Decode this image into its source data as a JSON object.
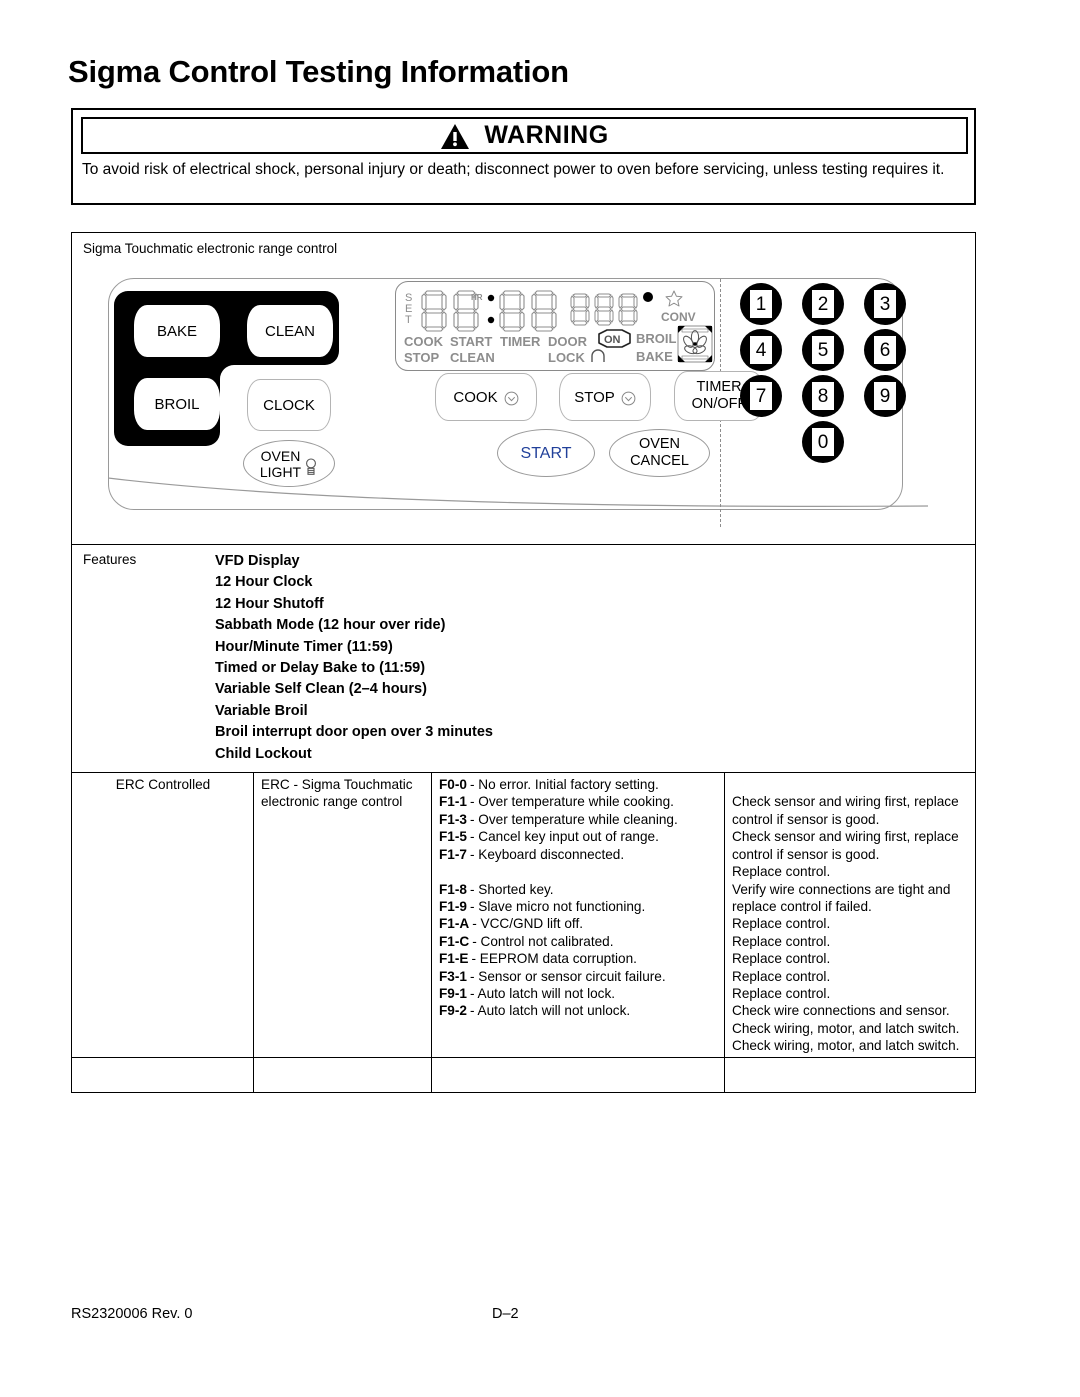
{
  "title": "Sigma Control Testing Information",
  "warning": {
    "heading": "WARNING",
    "icon": "warning-triangle-icon",
    "body": "To avoid risk of electrical shock, personal injury or death; disconnect power to oven before servicing, unless testing requires it."
  },
  "panel": {
    "caption": "Sigma Touchmatic electronic range control",
    "keys": {
      "bake": "BAKE",
      "clean": "CLEAN",
      "broil": "BROIL",
      "clock": "CLOCK",
      "oven_light_line1": "OVEN",
      "oven_light_line2": "LIGHT",
      "cook": "COOK",
      "stop": "STOP",
      "timer_line1": "TIMER",
      "timer_line2": "ON/OFF",
      "start": "START",
      "oven_cancel_line1": "OVEN",
      "oven_cancel_line2": "CANCEL"
    },
    "start_color": "#21409a",
    "keypad": [
      "1",
      "2",
      "3",
      "4",
      "5",
      "6",
      "7",
      "8",
      "9",
      "0"
    ],
    "vfd": {
      "set_indicator": "SET",
      "hr_marker": "HR",
      "row1": [
        "COOK",
        "START",
        "TIMER",
        "DOOR"
      ],
      "row2": [
        "STOP",
        "CLEAN",
        "LOCK"
      ],
      "on_indicator": "ON",
      "broil": "BROIL",
      "bake": "BAKE",
      "conv": "CONV",
      "icons": [
        "star-icon",
        "degree-dot-icon",
        "padlock-icon",
        "convection-fan-icon"
      ]
    }
  },
  "features": {
    "label": "Features",
    "items": [
      "VFD Display",
      "12 Hour Clock",
      "12 Hour Shutoff",
      "Sabbath Mode (12 hour over ride)",
      "Hour/Minute Timer (11:59)",
      "Timed or Delay Bake to (11:59)",
      "Variable Self Clean (2–4 hours)",
      "Variable Broil",
      "Broil interrupt door open over 3 minutes",
      "Child Lockout"
    ]
  },
  "error_table": {
    "category": "ERC Controlled",
    "control_name": "ERC - Sigma Touchmatic electronic range control",
    "codes": [
      {
        "id": "F0-0",
        "desc": "No error. Initial factory setting.",
        "remedy": ""
      },
      {
        "id": "F1-1",
        "desc": "Over temperature while cooking.",
        "remedy": "Check sensor and wiring first, replace control if sensor is good."
      },
      {
        "id": "F1-3",
        "desc": "Over temperature while cleaning.",
        "remedy": "Check sensor and wiring first, replace control if sensor is good."
      },
      {
        "id": "F1-5",
        "desc": "Cancel key input out of range.",
        "remedy": "Replace control."
      },
      {
        "id": "F1-7",
        "desc": "Keyboard disconnected.",
        "remedy": "Verify wire connections are tight and replace control if failed."
      },
      {
        "id": "F1-8",
        "desc": "Shorted key.",
        "remedy": "Replace control."
      },
      {
        "id": "F1-9",
        "desc": "Slave micro not functioning.",
        "remedy": "Replace control."
      },
      {
        "id": "F1-A",
        "desc": "VCC/GND lift off.",
        "remedy": "Replace control."
      },
      {
        "id": "F1-C",
        "desc": "Control not calibrated.",
        "remedy": "Replace control."
      },
      {
        "id": "F1-E",
        "desc": "EEPROM data corruption.",
        "remedy": "Replace control."
      },
      {
        "id": "F3-1",
        "desc": "Sensor or sensor circuit failure.",
        "remedy": "Check wire connections and sensor."
      },
      {
        "id": "F9-1",
        "desc": "Auto latch will not lock.",
        "remedy": "Check wiring, motor, and latch switch."
      },
      {
        "id": "F9-2",
        "desc": "Auto latch will not unlock.",
        "remedy": "Check wiring, motor, and latch switch."
      }
    ]
  },
  "footer": {
    "doc_id": "RS2320006  Rev. 0",
    "page": "D–2"
  }
}
